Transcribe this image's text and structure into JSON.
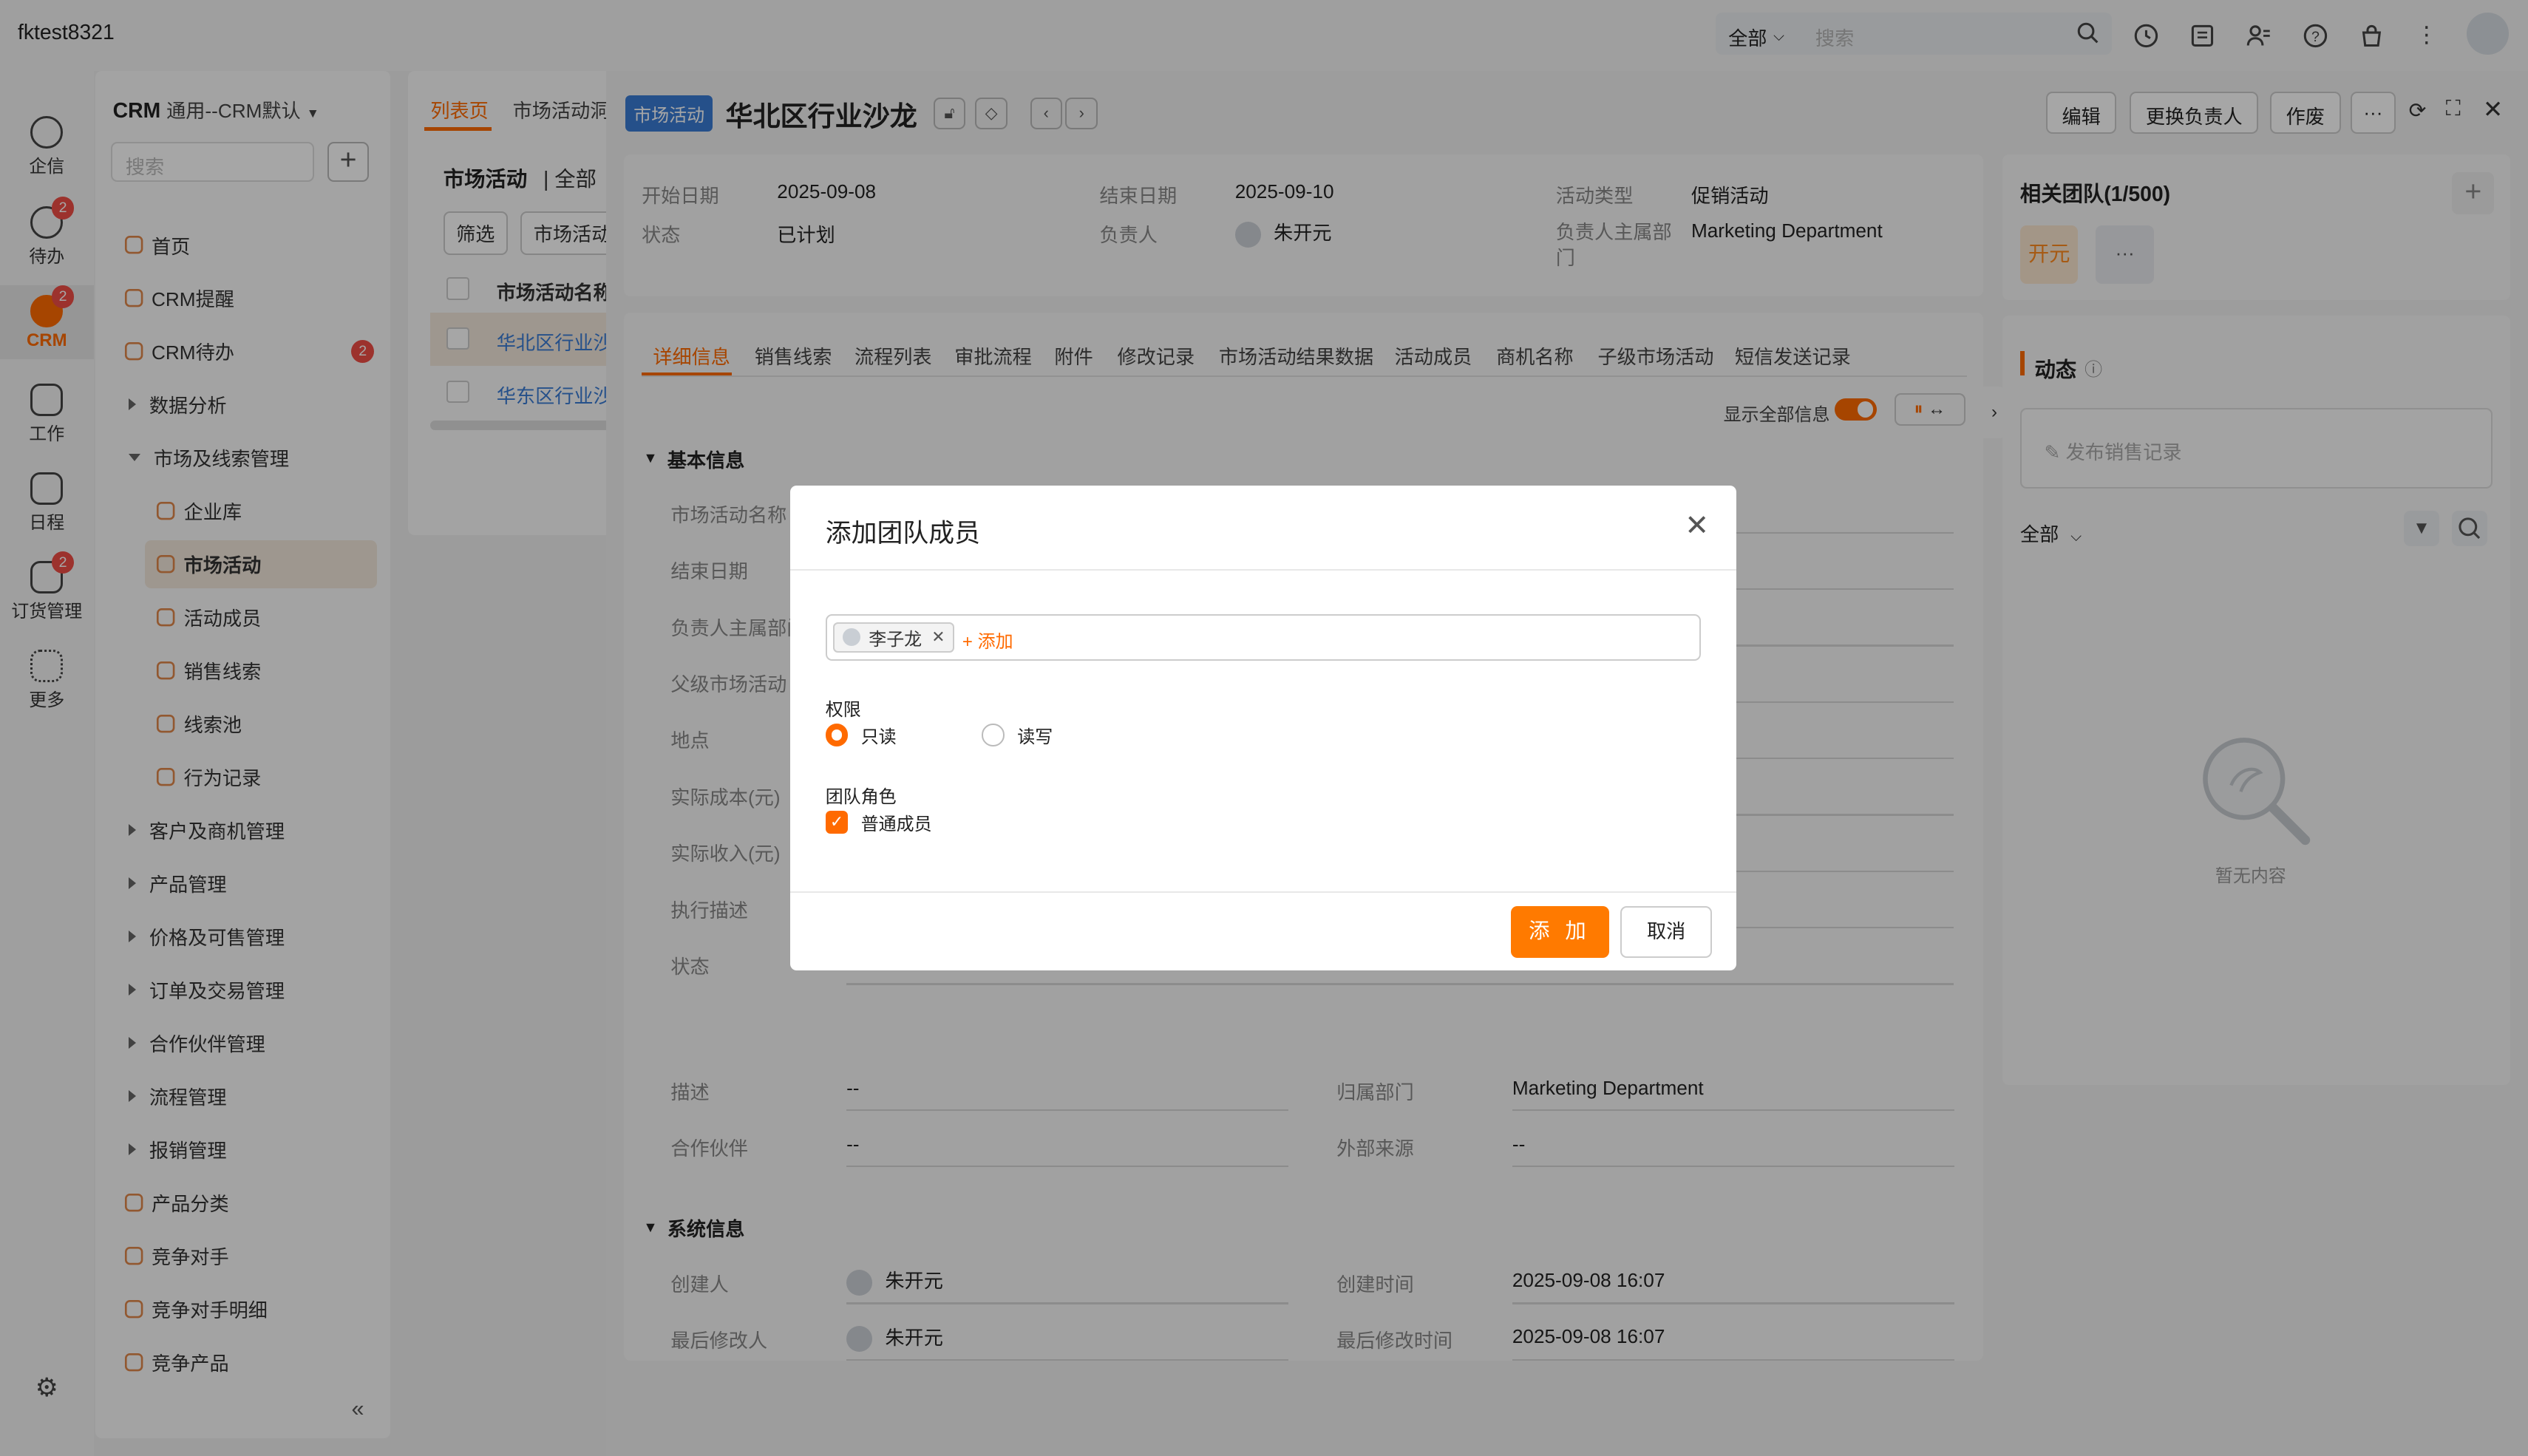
{
  "topbar": {
    "tenant": "fktest8321",
    "search_scope": "全部",
    "search_placeholder": "搜索",
    "icons": [
      "clock-icon",
      "inbox-icon",
      "contacts-icon",
      "help-icon",
      "bag-icon",
      "more-vertical-icon"
    ]
  },
  "rail": [
    {
      "label": "企信",
      "icon": "chat-icon",
      "badge": ""
    },
    {
      "label": "待办",
      "icon": "check-circle-icon",
      "badge": "2"
    },
    {
      "label": "CRM",
      "icon": "crm-icon",
      "badge": "2",
      "active": true
    },
    {
      "label": "工作",
      "icon": "briefcase-icon",
      "badge": ""
    },
    {
      "label": "日程",
      "icon": "calendar-icon",
      "badge": ""
    },
    {
      "label": "订货管理",
      "icon": "order-icon",
      "badge": "2"
    },
    {
      "label": "更多",
      "icon": "grid-icon",
      "badge": ""
    }
  ],
  "sidebar": {
    "title": "CRM",
    "subtitle": "通用--CRM默认",
    "search_placeholder": "搜索",
    "items": [
      {
        "label": "首页",
        "type": "leaf",
        "icon": "home-icon"
      },
      {
        "label": "CRM提醒",
        "type": "leaf",
        "icon": "bell-icon"
      },
      {
        "label": "CRM待办",
        "type": "leaf",
        "icon": "check-icon",
        "badge": "2"
      },
      {
        "label": "数据分析",
        "type": "group"
      },
      {
        "label": "市场及线索管理",
        "type": "group-open"
      },
      {
        "label": "企业库",
        "type": "child",
        "icon": "building-icon"
      },
      {
        "label": "市场活动",
        "type": "child",
        "icon": "megaphone-icon",
        "selected": true
      },
      {
        "label": "活动成员",
        "type": "child",
        "icon": "user-icon"
      },
      {
        "label": "销售线索",
        "type": "child",
        "icon": "lead-icon"
      },
      {
        "label": "线索池",
        "type": "child",
        "icon": "pool-icon"
      },
      {
        "label": "行为记录",
        "type": "child",
        "icon": "record-icon"
      },
      {
        "label": "客户及商机管理",
        "type": "group"
      },
      {
        "label": "产品管理",
        "type": "group"
      },
      {
        "label": "价格及可售管理",
        "type": "group"
      },
      {
        "label": "订单及交易管理",
        "type": "group"
      },
      {
        "label": "合作伙伴管理",
        "type": "group"
      },
      {
        "label": "流程管理",
        "type": "group"
      },
      {
        "label": "报销管理",
        "type": "group"
      },
      {
        "label": "产品分类",
        "type": "leaf",
        "icon": "category-icon"
      },
      {
        "label": "竞争对手",
        "type": "leaf",
        "icon": "vs-icon"
      },
      {
        "label": "竞争对手明细",
        "type": "leaf",
        "icon": "detail-icon"
      },
      {
        "label": "竞争产品",
        "type": "leaf",
        "icon": "product-icon"
      }
    ]
  },
  "listpanel": {
    "tab_active": "列表页",
    "tab2": "市场活动洞",
    "view_title": "市场活动",
    "view_scope": "全部",
    "filter_btn": "筛选",
    "type_btn": "市场活动",
    "col_header": "市场活动名称",
    "rows": [
      "华北区行业沙",
      "华东区行业沙"
    ]
  },
  "detail": {
    "tag": "市场活动",
    "title": "华北区行业沙龙",
    "buttons": [
      "编辑",
      "更换负责人",
      "作废"
    ],
    "summary": [
      {
        "label": "开始日期",
        "value": "2025-09-08"
      },
      {
        "label": "结束日期",
        "value": "2025-09-10"
      },
      {
        "label": "活动类型",
        "value": "促销活动"
      },
      {
        "label": "状态",
        "value": "已计划"
      },
      {
        "label": "负责人",
        "value": "朱开元"
      },
      {
        "label": "负责人主属部门",
        "value": "Marketing Department"
      }
    ],
    "tabs": [
      "详细信息",
      "销售线索",
      "流程列表",
      "审批流程",
      "附件",
      "修改记录",
      "市场活动结果数据",
      "活动成员",
      "商机名称",
      "子级市场活动",
      "短信发送记录"
    ],
    "show_all_label": "显示全部信息",
    "basic_section": "基本信息",
    "basic_fields": [
      "市场活动名称",
      "结束日期",
      "负责人主属部门",
      "父级市场活动",
      "地点",
      "实际成本(元)",
      "实际收入(元)",
      "执行描述",
      "状态"
    ],
    "desc_label": "描述",
    "desc_value": "--",
    "dept_label": "归属部门",
    "dept_value": "Marketing Department",
    "partner_label": "合作伙伴",
    "partner_value": "--",
    "ext_label": "外部来源",
    "ext_value": "--",
    "system_section": "系统信息",
    "creator_label": "创建人",
    "creator_value": "朱开元",
    "created_label": "创建时间",
    "created_value": "2025-09-08 16:07",
    "modifier_label": "最后修改人",
    "modifier_value": "朱开元",
    "modified_label": "最后修改时间",
    "modified_value": "2025-09-08 16:07"
  },
  "team": {
    "title": "相关团队(1/500)",
    "member": "开元",
    "more": "···"
  },
  "feed": {
    "title": "动态",
    "post_placeholder": "发布销售记录",
    "filter": "全部",
    "empty": "暂无内容"
  },
  "modal": {
    "title": "添加团队成员",
    "selected_user": "李子龙",
    "add_link": "+ 添加",
    "permission_label": "权限",
    "perm_readonly": "只读",
    "perm_readwrite": "读写",
    "role_label": "团队角色",
    "role_value": "普通成员",
    "ok": "添 加",
    "cancel": "取消"
  },
  "colors": {
    "accent": "#ff6a00",
    "tag_blue": "#3a7bd5",
    "badge_red": "#f04e45"
  }
}
